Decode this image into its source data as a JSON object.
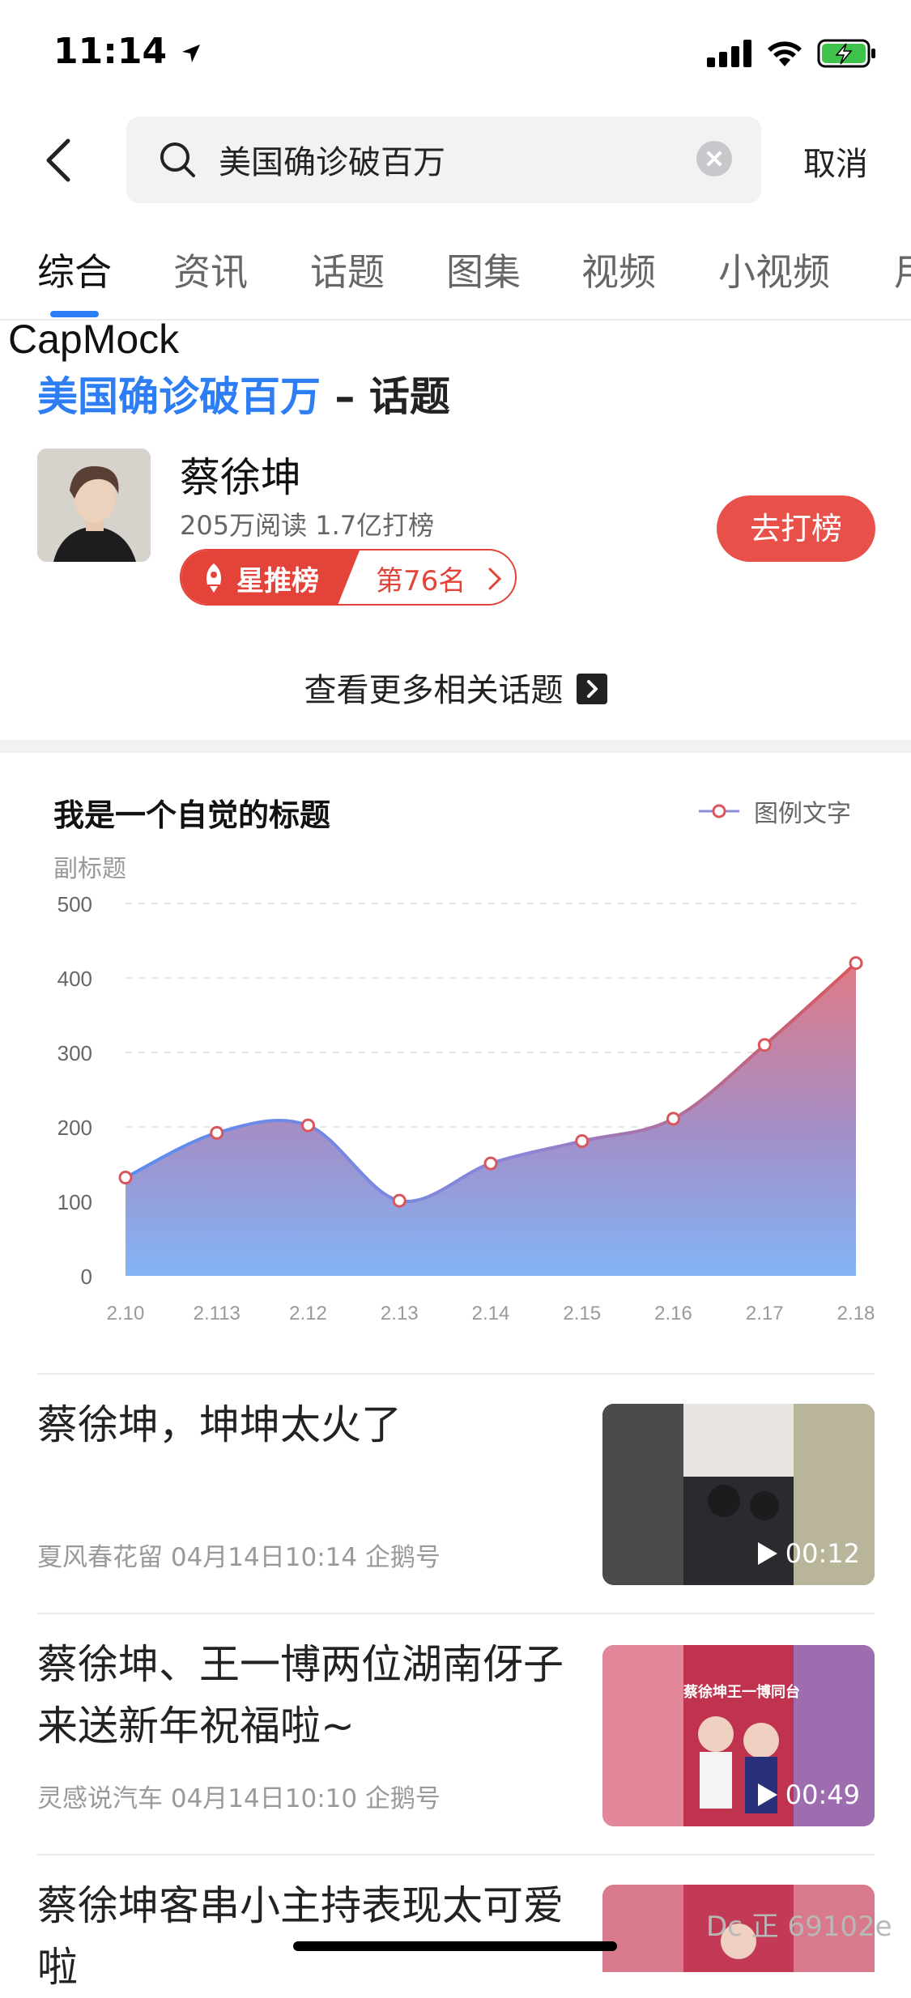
{
  "status_bar": {
    "time": "11:14"
  },
  "search": {
    "query": "美国确诊破百万",
    "cancel_label": "取消"
  },
  "tabs": [
    {
      "label": "综合"
    },
    {
      "label": "资讯"
    },
    {
      "label": "话题"
    },
    {
      "label": "图集"
    },
    {
      "label": "视频"
    },
    {
      "label": "小视频"
    },
    {
      "label": "用"
    }
  ],
  "overlay_label": "CapMock",
  "topic": {
    "highlight": "美国确诊破百万",
    "suffix": " – 话题",
    "person_name": "蔡徐坤",
    "stats": "205万阅读  1.7亿打榜",
    "badge_label": "星推榜",
    "badge_rank": "第76名",
    "vote_label": "去打榜",
    "more_label": "查看更多相关话题"
  },
  "chart": {
    "title": "我是一个自觉的标题",
    "subtitle": "副标题",
    "legend": "图例文字",
    "accent_line": "#5b8def",
    "point_color": "#d9565c"
  },
  "chart_data": {
    "type": "area",
    "title": "我是一个自觉的标题",
    "subtitle": "副标题",
    "categories": [
      "2.10",
      "2.113",
      "2.12",
      "2.13",
      "2.14",
      "2.15",
      "2.16",
      "2.17",
      "2.18"
    ],
    "series": [
      {
        "name": "图例文字",
        "values": [
          132,
          192,
          202,
          101,
          151,
          181,
          211,
          310,
          420
        ]
      }
    ],
    "ylim": [
      0,
      500
    ],
    "yticks": [
      0,
      100,
      200,
      300,
      400,
      500
    ],
    "grid": true,
    "legend_position": "top-right",
    "smooth": true
  },
  "news": [
    {
      "title": "蔡徐坤，坤坤太火了",
      "meta": "夏风春花留  04月14日10:14  企鹅号",
      "duration": "00:12"
    },
    {
      "title": "蔡徐坤、王一博两位湖南伢子来送新年祝福啦~",
      "meta": "灵感说汽车  04月14日10:10  企鹅号",
      "duration": "00:49",
      "thumb_caption": "蔡徐坤王一博同台"
    },
    {
      "title": "蔡徐坤客串小主持表现太可爱啦"
    }
  ],
  "watermark": "Dc 正 69102e"
}
